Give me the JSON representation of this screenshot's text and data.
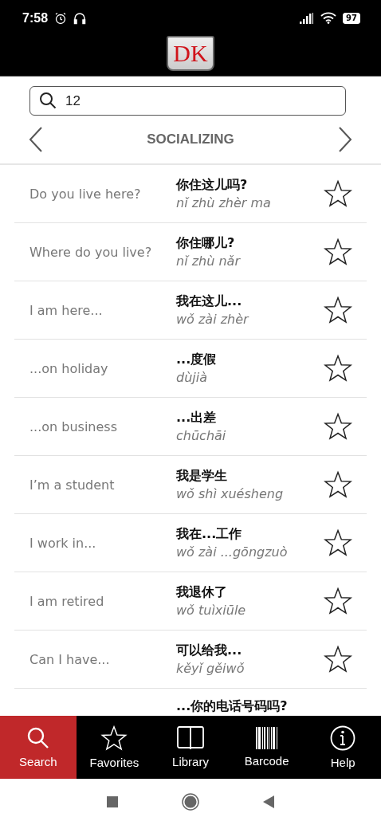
{
  "status_bar": {
    "time": "7:58",
    "battery": "97"
  },
  "header": {
    "logo_text": "DK"
  },
  "search": {
    "value": "12"
  },
  "category": {
    "title": "SOCIALIZING"
  },
  "rows": [
    {
      "english": "Do you live here?",
      "chinese": "你住这儿吗?",
      "pinyin": "nǐ zhù zhèr ma",
      "favorite": false
    },
    {
      "english": "Where do you live?",
      "chinese": "你住哪儿?",
      "pinyin": "nǐ zhù nǎr",
      "favorite": false
    },
    {
      "english": "I am here...",
      "chinese": "我在这儿...",
      "pinyin": "wǒ zài zhèr",
      "favorite": false
    },
    {
      "english": "...on holiday",
      "chinese": "...度假",
      "pinyin": "dùjià",
      "favorite": false
    },
    {
      "english": "...on business",
      "chinese": "...出差",
      "pinyin": "chūchāi",
      "favorite": false
    },
    {
      "english": "I’m a student",
      "chinese": "我是学生",
      "pinyin": "wǒ shì xuésheng",
      "favorite": false
    },
    {
      "english": "I work in...",
      "chinese": "我在...工作",
      "pinyin": "wǒ zài ...gōngzuò",
      "favorite": false
    },
    {
      "english": "I am retired",
      "chinese": "我退休了",
      "pinyin": "wǒ tuìxiūle",
      "favorite": false
    },
    {
      "english": "Can I have...",
      "chinese": "可以给我...",
      "pinyin": "kěyǐ gěiwǒ",
      "favorite": false
    },
    {
      "chinese": "...你的电话号码吗?"
    }
  ],
  "tabs": [
    {
      "kind": "search",
      "label": "Search",
      "selected": true
    },
    {
      "kind": "favorites",
      "label": "Favorites",
      "selected": false
    },
    {
      "kind": "library",
      "label": "Library",
      "selected": false
    },
    {
      "kind": "barcode",
      "label": "Barcode",
      "selected": false
    },
    {
      "kind": "help",
      "label": "Help",
      "selected": false
    }
  ]
}
